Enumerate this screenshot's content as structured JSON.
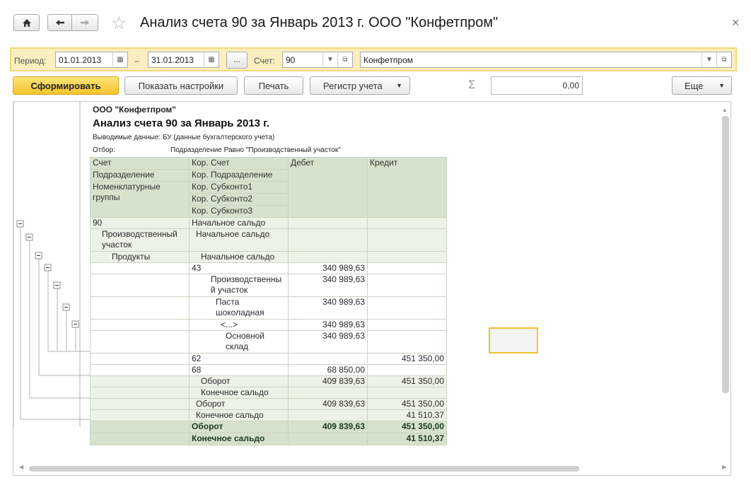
{
  "window": {
    "title": "Анализ счета 90 за Январь 2013 г. ООО \"Конфетпром\"",
    "close_glyph": "×"
  },
  "nav": {
    "home_icon": "home-icon",
    "back_icon": "arrow-left-icon",
    "forward_icon": "arrow-right-icon",
    "favorite_icon": "star-icon"
  },
  "filters": {
    "period_label": "Период:",
    "date_from": "01.01.2013",
    "dash": "–",
    "date_to": "31.01.2013",
    "dots": "...",
    "account_label": "Счет:",
    "account": "90",
    "organization": "Конфетпром"
  },
  "toolbar": {
    "generate": "Сформировать",
    "show_settings": "Показать настройки",
    "print": "Печать",
    "register": "Регистр учета",
    "sigma": "Σ",
    "sum_value": "0,00",
    "more": "Еще"
  },
  "report": {
    "company": "ООО \"Конфетпром\"",
    "title": "Анализ счета 90 за Январь 2013 г.",
    "output_label": "Выводимые данные:  БУ (данные бухгалтерского учета)",
    "filter_label": "Отбор:",
    "filter_value": "Подразделение Равно \"Производственный участок\"",
    "headers": {
      "account": "Счет",
      "division": "Подразделение",
      "nomenclature": "Номенклатурные группы",
      "corr_account": "Кор. Счет",
      "corr_division": "Кор. Подразделение",
      "corr_sub1": "Кор. Субконто1",
      "corr_sub2": "Кор. Субконто2",
      "corr_sub3": "Кор. Субконто3",
      "debit": "Дебет",
      "credit": "Кредит"
    },
    "rows": [
      {
        "c1": "90",
        "c2": "Начальное сальдо",
        "d": "",
        "k": ""
      },
      {
        "c1": "Производственный участок",
        "c2": "Начальное сальдо",
        "d": "",
        "k": ""
      },
      {
        "c1": "Продукты",
        "c2": "Начальное сальдо",
        "d": "",
        "k": ""
      },
      {
        "c1": "",
        "c2": "43",
        "d": "340 989,63",
        "k": ""
      },
      {
        "c1": "",
        "c2": "Производственный участок",
        "d": "340 989,63",
        "k": ""
      },
      {
        "c1": "",
        "c2": "Паста шоколадная",
        "d": "340 989,63",
        "k": ""
      },
      {
        "c1": "",
        "c2": "<...>",
        "d": "340 989,63",
        "k": ""
      },
      {
        "c1": "",
        "c2": "Основной склад",
        "d": "340 989,63",
        "k": ""
      },
      {
        "c1": "",
        "c2": "62",
        "d": "",
        "k": "451 350,00"
      },
      {
        "c1": "",
        "c2": "68",
        "d": "68 850,00",
        "k": ""
      },
      {
        "c1": "",
        "c2": "Оборот",
        "d": "409 839,63",
        "k": "451 350,00"
      },
      {
        "c1": "",
        "c2": "Конечное сальдо",
        "d": "",
        "k": ""
      },
      {
        "c1": "",
        "c2": "Оборот",
        "d": "409 839,63",
        "k": "451 350,00"
      },
      {
        "c1": "",
        "c2": "Конечное сальдо",
        "d": "",
        "k": "41 510,37"
      },
      {
        "c1": "",
        "c2": "Оборот",
        "d": "409 839,63",
        "k": "451 350,00"
      },
      {
        "c1": "",
        "c2": "Конечное сальдо",
        "d": "",
        "k": "41 510,37"
      }
    ]
  }
}
